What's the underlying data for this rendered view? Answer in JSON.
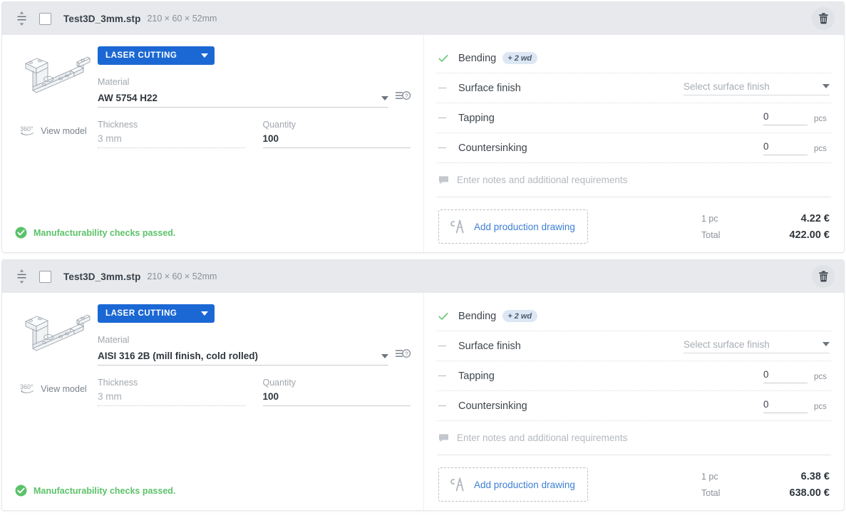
{
  "cards": [
    {
      "header": {
        "filename": "Test3D_3mm.stp",
        "dimensions": "210 × 60 × 52mm",
        "drag_handle_icon": "drag-handle-icon",
        "checkbox_icon": "checkbox-unchecked-icon",
        "delete_icon": "trash-icon"
      },
      "preview": {
        "model_icon": "3d-bracket-model",
        "view_model_badge": "360°",
        "view_model_label": "View model"
      },
      "process": {
        "label": "LASER CUTTING",
        "caret_icon": "chevron-down-icon"
      },
      "material": {
        "label": "Material",
        "value": "AW 5754 H22",
        "caret_icon": "chevron-down-icon",
        "info_icon": "material-info-icon"
      },
      "thickness": {
        "label": "Thickness",
        "value": "3 mm"
      },
      "quantity": {
        "label": "Quantity",
        "value": "100"
      },
      "manufacturability": {
        "icon": "check-circle-icon",
        "text": "Manufacturability checks passed."
      },
      "operations": [
        {
          "status_icon": "check-icon",
          "name": "Bending",
          "badge": "+ 2 wd",
          "control": "none"
        },
        {
          "status_icon": "dash-icon",
          "name": "Surface finish",
          "control": "select",
          "placeholder": "Select surface finish",
          "caret_icon": "chevron-down-icon"
        },
        {
          "status_icon": "dash-icon",
          "name": "Tapping",
          "control": "number",
          "value": "0",
          "unit": "pcs"
        },
        {
          "status_icon": "dash-icon",
          "name": "Countersinking",
          "control": "number",
          "value": "0",
          "unit": "pcs"
        }
      ],
      "notes": {
        "icon": "comment-icon",
        "placeholder": "Enter notes and additional requirements"
      },
      "add_drawing": {
        "icon": "compass-drafting-icon",
        "label": "Add production drawing"
      },
      "pricing": {
        "unit_label": "1 pc",
        "unit_value": "4.22 €",
        "total_label": "Total",
        "total_value": "422.00 €"
      }
    },
    {
      "header": {
        "filename": "Test3D_3mm.stp",
        "dimensions": "210 × 60 × 52mm",
        "drag_handle_icon": "drag-handle-icon",
        "checkbox_icon": "checkbox-unchecked-icon",
        "delete_icon": "trash-icon"
      },
      "preview": {
        "model_icon": "3d-bracket-model",
        "view_model_badge": "360°",
        "view_model_label": "View model"
      },
      "process": {
        "label": "LASER CUTTING",
        "caret_icon": "chevron-down-icon"
      },
      "material": {
        "label": "Material",
        "value": "AISI 316 2B (mill finish, cold rolled)",
        "caret_icon": "chevron-down-icon",
        "info_icon": "material-info-icon"
      },
      "thickness": {
        "label": "Thickness",
        "value": "3 mm"
      },
      "quantity": {
        "label": "Quantity",
        "value": "100"
      },
      "manufacturability": {
        "icon": "check-circle-icon",
        "text": "Manufacturability checks passed."
      },
      "operations": [
        {
          "status_icon": "check-icon",
          "name": "Bending",
          "badge": "+ 2 wd",
          "control": "none"
        },
        {
          "status_icon": "dash-icon",
          "name": "Surface finish",
          "control": "select",
          "placeholder": "Select surface finish",
          "caret_icon": "chevron-down-icon"
        },
        {
          "status_icon": "dash-icon",
          "name": "Tapping",
          "control": "number",
          "value": "0",
          "unit": "pcs"
        },
        {
          "status_icon": "dash-icon",
          "name": "Countersinking",
          "control": "number",
          "value": "0",
          "unit": "pcs"
        }
      ],
      "notes": {
        "icon": "comment-icon",
        "placeholder": "Enter notes and additional requirements"
      },
      "add_drawing": {
        "icon": "compass-drafting-icon",
        "label": "Add production drawing"
      },
      "pricing": {
        "unit_label": "1 pc",
        "unit_value": "6.38 €",
        "total_label": "Total",
        "total_value": "638.00 €"
      }
    }
  ],
  "colors": {
    "process_button": "#1b68d4",
    "link": "#3d7fd4",
    "success": "#5cc26a",
    "badge_bg": "#dde7f4",
    "header_bg": "#e7e9ec"
  }
}
